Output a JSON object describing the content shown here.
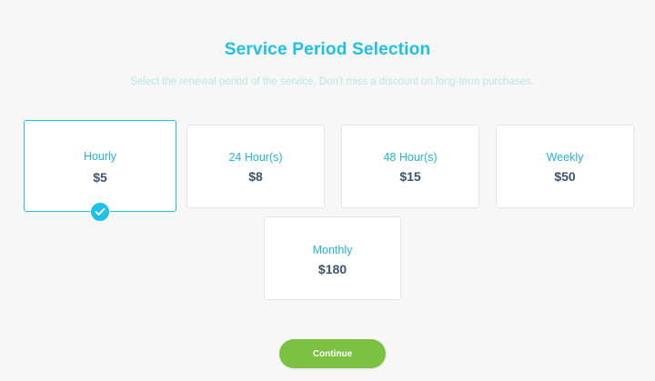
{
  "header": {
    "title": "Service Period Selection",
    "subtitle": "Select the renewal period of the service. Don't miss a discount on long-term purchases."
  },
  "options": [
    {
      "label": "Hourly",
      "price": "$5",
      "selected": true
    },
    {
      "label": "24 Hour(s)",
      "price": "$8",
      "selected": false
    },
    {
      "label": "48 Hour(s)",
      "price": "$15",
      "selected": false
    },
    {
      "label": "Weekly",
      "price": "$50",
      "selected": false
    },
    {
      "label": "Monthly",
      "price": "$180",
      "selected": false
    }
  ],
  "icons": {
    "selected_indicator": "check-circle-icon"
  },
  "colors": {
    "accent": "#1ec0e6",
    "price": "#3b5570",
    "button": "#7cc242"
  },
  "actions": {
    "continue_label": "Continue"
  }
}
